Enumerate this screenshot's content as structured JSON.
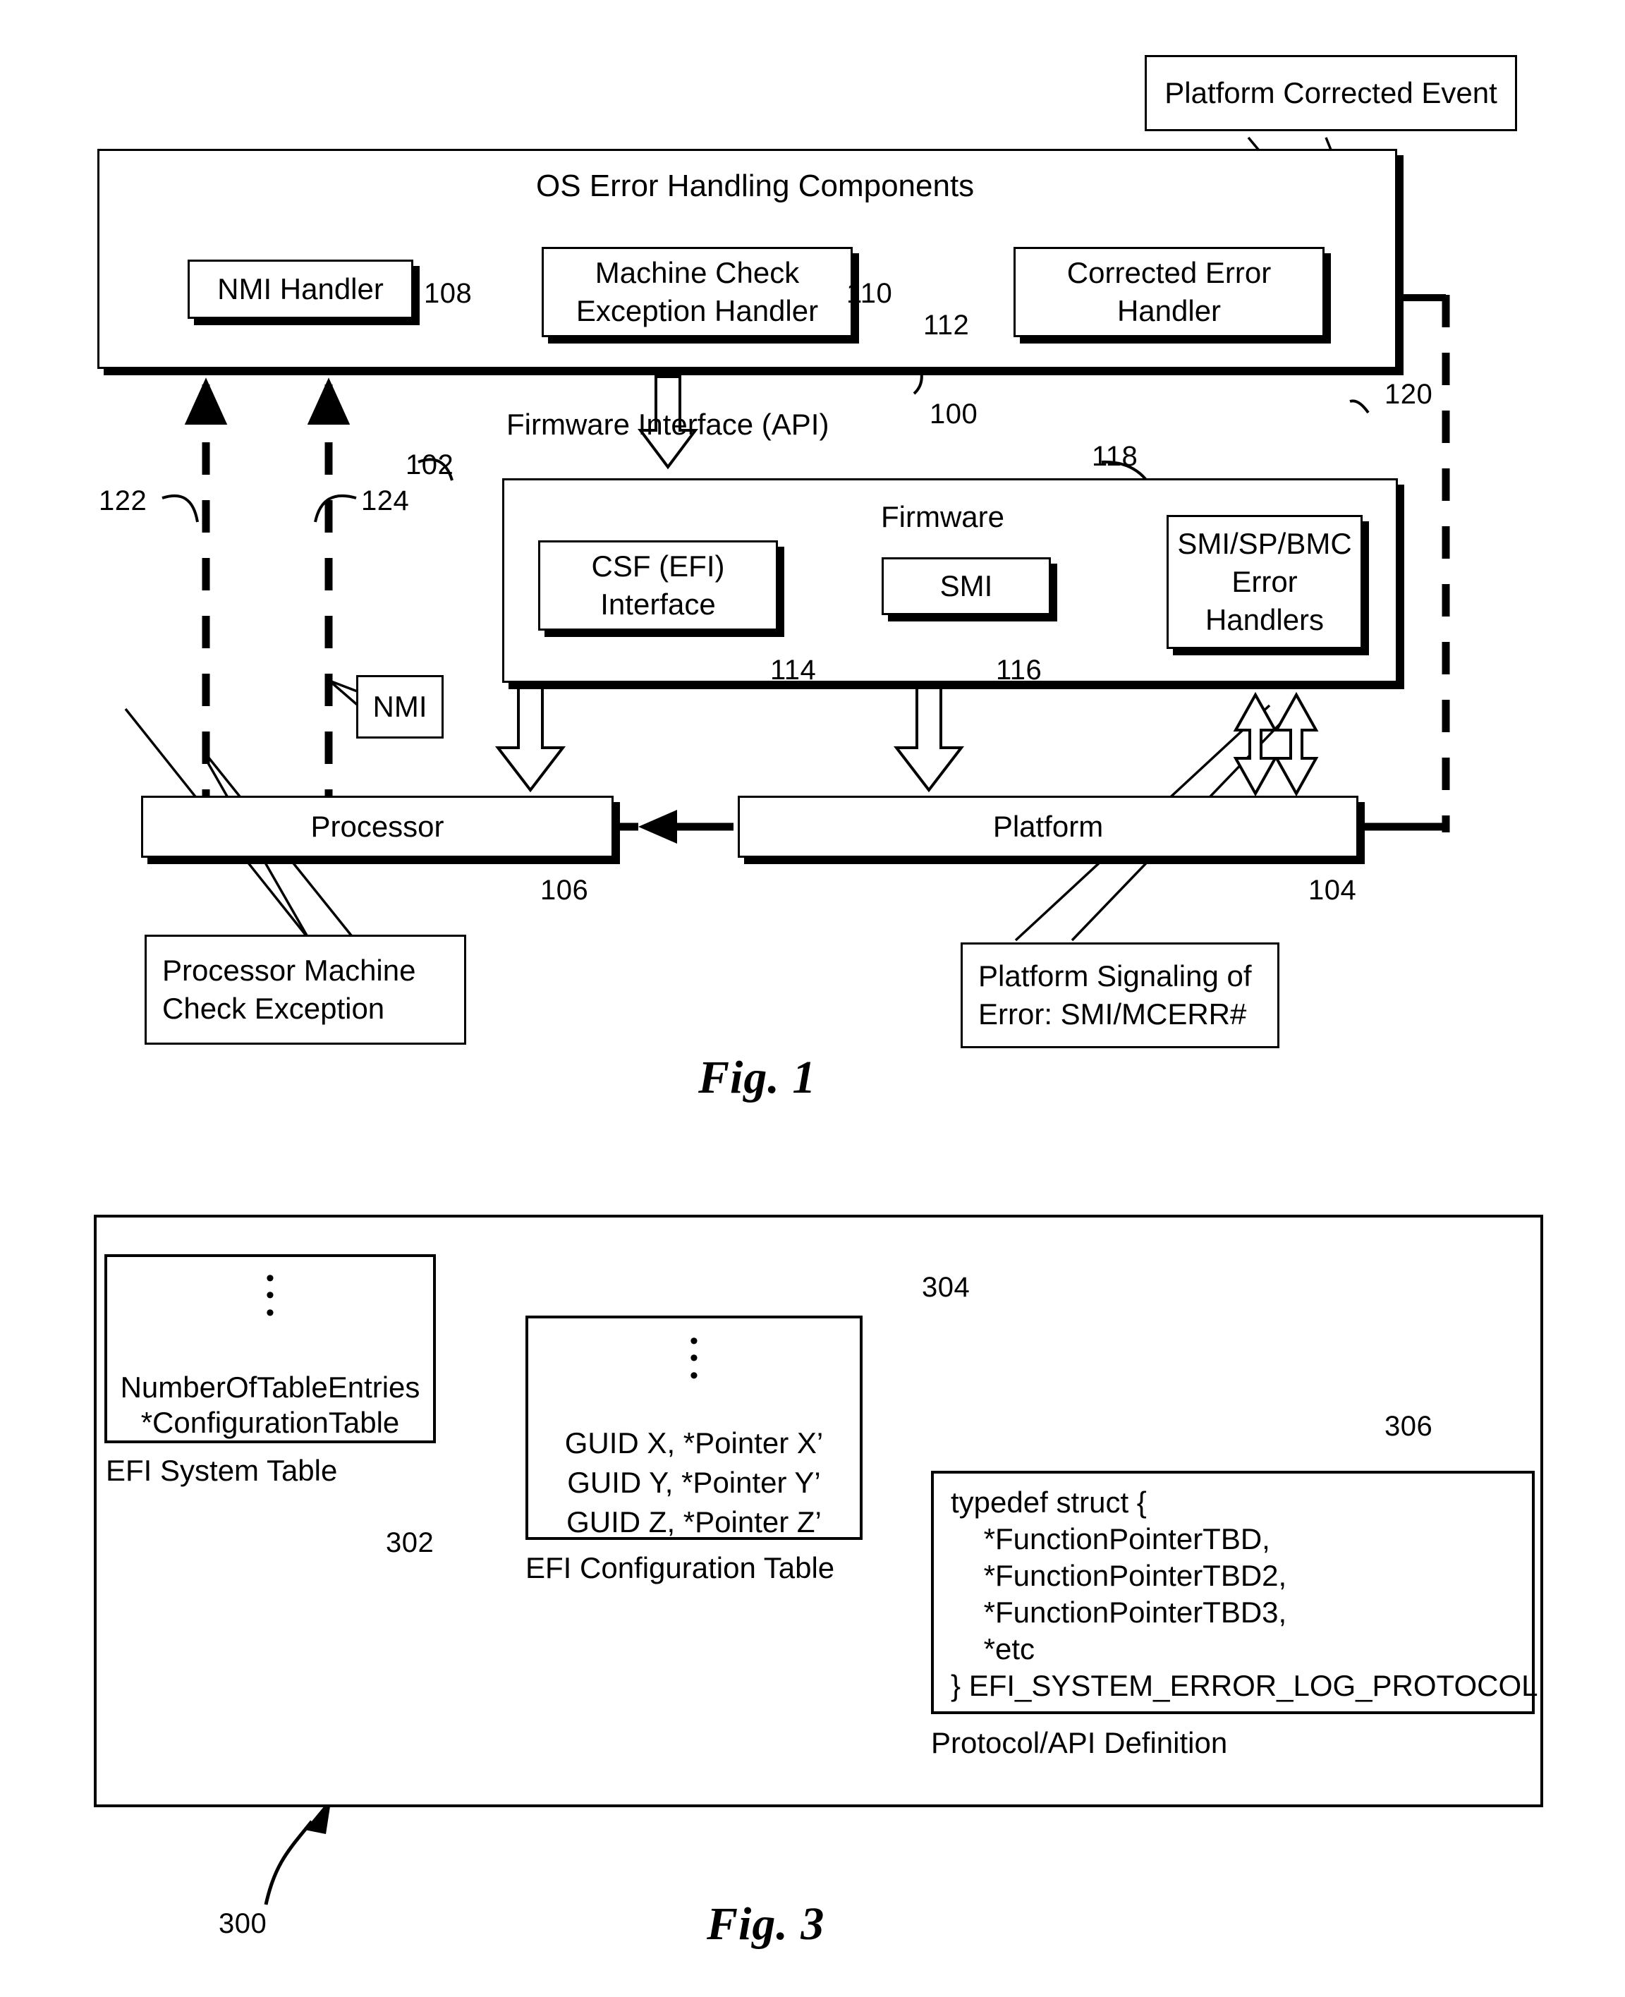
{
  "figure1": {
    "caption": "Fig. 1",
    "os_layer": {
      "title": "OS Error Handling Components",
      "ref": "100",
      "boxes": [
        {
          "label": "NMI Handler",
          "ref": "108"
        },
        {
          "label": "Machine Check\nException Handler",
          "ref": "110"
        },
        {
          "label": "Corrected Error\nHandler",
          "ref": "112"
        }
      ]
    },
    "interface_label": "Firmware Interface (API)",
    "firmware_layer": {
      "title": "Firmware",
      "ref": "102",
      "boxes": [
        {
          "label": "CSF (EFI)\nInterface",
          "ref": "114"
        },
        {
          "label": "SMI",
          "ref": "116"
        },
        {
          "label": "SMI/SP/BMC\nError\nHandlers",
          "ref": "118"
        }
      ]
    },
    "hardware": [
      {
        "label": "Processor",
        "ref": "106"
      },
      {
        "label": "Platform",
        "ref": "104"
      }
    ],
    "callouts": [
      {
        "label": "Platform Corrected Event"
      },
      {
        "label": "Processor Machine\nCheck Exception"
      },
      {
        "label": "Platform Signaling of\nError:  SMI/MCERR#"
      }
    ],
    "nmi_signal": "NMI",
    "bus_refs": [
      {
        "ref": "120"
      },
      {
        "ref": "122"
      },
      {
        "ref": "124"
      }
    ]
  },
  "figure3": {
    "caption": "Fig. 3",
    "ref": "300",
    "efi_system_table": {
      "ellipsis": "•\n•\n•",
      "lines": [
        "NumberOfTableEntries",
        "*ConfigurationTable"
      ],
      "caption": "EFI System Table",
      "ref": "302"
    },
    "efi_configuration_table": {
      "ellipsis": "•\n•\n•",
      "lines": [
        "GUID X, *Pointer X’",
        "GUID Y, *Pointer Y’",
        "GUID Z, *Pointer Z’"
      ],
      "caption": "EFI Configuration Table",
      "ref": "304"
    },
    "protocol_definition": {
      "lines": [
        "typedef struct {",
        "    *FunctionPointerTBD,",
        "    *FunctionPointerTBD2,",
        "    *FunctionPointerTBD3,",
        "    *etc",
        "} EFI_SYSTEM_ERROR_LOG_PROTOCOL"
      ],
      "caption": "Protocol/API Definition",
      "ref": "306"
    }
  },
  "colors": {
    "ink": "#000000",
    "paper": "#ffffff"
  }
}
